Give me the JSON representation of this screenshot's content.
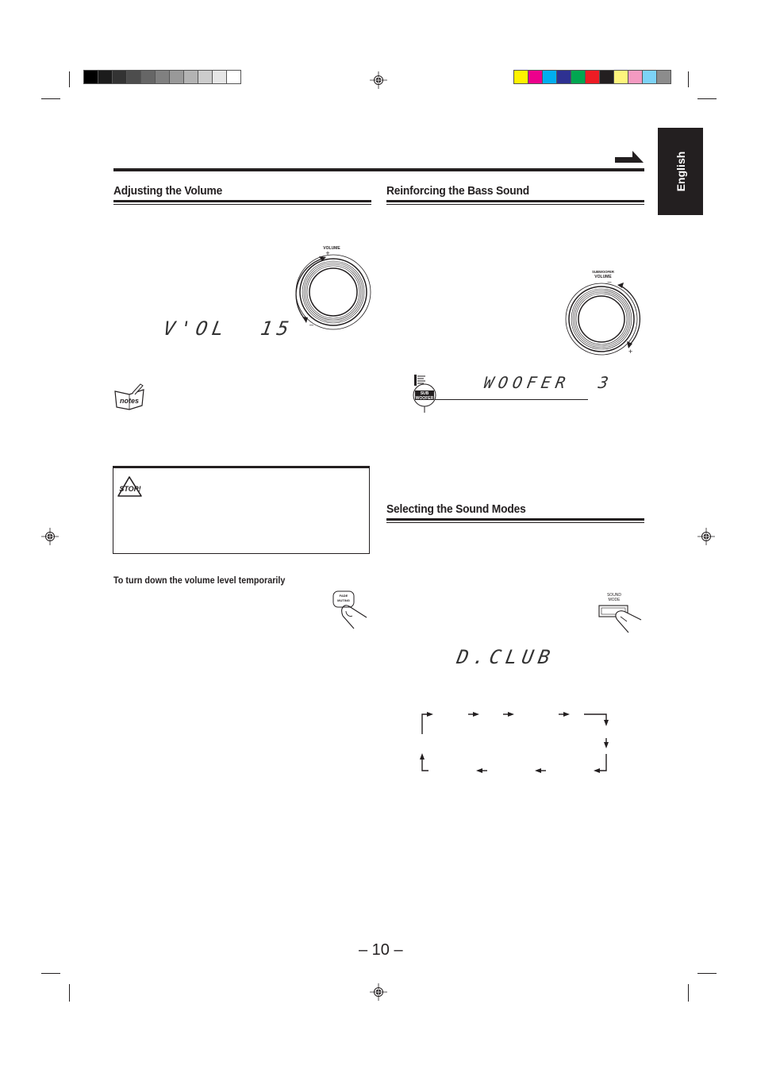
{
  "calibration": {
    "grayscale": [
      "#000000",
      "#1c1c1c",
      "#333333",
      "#4d4d4d",
      "#666666",
      "#808080",
      "#999999",
      "#b3b3b3",
      "#cccccc",
      "#e6e6e6",
      "#ffffff"
    ],
    "colors": [
      "#fff200",
      "#ec008c",
      "#00aeef",
      "#2e3192",
      "#00a651",
      "#ed1c24",
      "#231f20",
      "#fff57d",
      "#f49ac1",
      "#7dd3f7",
      "#8c8c8c"
    ]
  },
  "language_tab": "English",
  "sections": {
    "volume": {
      "title": "Adjusting the Volume",
      "knob_label": "VOLUME",
      "plus": "+",
      "minus": "–",
      "display": "V'OL  15",
      "notes_icon_label": "notes",
      "stop_icon_label": "STOP!",
      "temp_heading": "To turn down the volume level temporarily",
      "fade_button_label_1": "FADE",
      "fade_button_label_2": "MUTING"
    },
    "bass": {
      "title": "Reinforcing the Bass Sound",
      "knob_label_1": "SUBWOOFER",
      "knob_label_2": "VOLUME",
      "plus": "+",
      "minus": "–",
      "display": "WOOFER  3",
      "indicator_label_1": "SUB",
      "indicator_label_2": "WOOFER"
    },
    "sound_modes": {
      "title": "Selecting the Sound Modes",
      "button_label_1": "SOUND",
      "button_label_2": "MODE",
      "display": "D.CLUB"
    }
  },
  "page_number": "– 10 –"
}
